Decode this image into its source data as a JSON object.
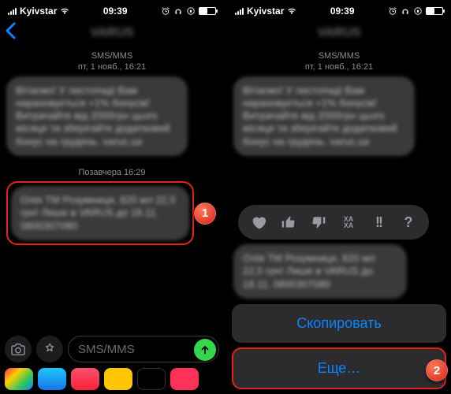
{
  "status": {
    "carrier": "Kyivstar",
    "time": "09:39"
  },
  "nav": {
    "title": "VARUS"
  },
  "header": {
    "type": "SMS/MMS",
    "date": "пт, 1 нояб., 16:21"
  },
  "messages": {
    "first_blurred": "Вітаємо! У листопаді Вам нараховується +1% бонусів! Витрачайте від 2000грн цього місяця та зберігайте додатковий бонус на грудень. varus.ua",
    "divider": "Позавчера 16:29",
    "second_blurred": "Олія ТМ Розумниця, 820 мл  22,5 грн! Лише в VARUS до 18.11. 0800307080"
  },
  "compose": {
    "placeholder": "SMS/MMS"
  },
  "sheet": {
    "copy": "Скопировать",
    "more": "Еще…"
  },
  "badges": {
    "one": "1",
    "two": "2"
  },
  "reactions": {
    "haha": "XA XA"
  }
}
